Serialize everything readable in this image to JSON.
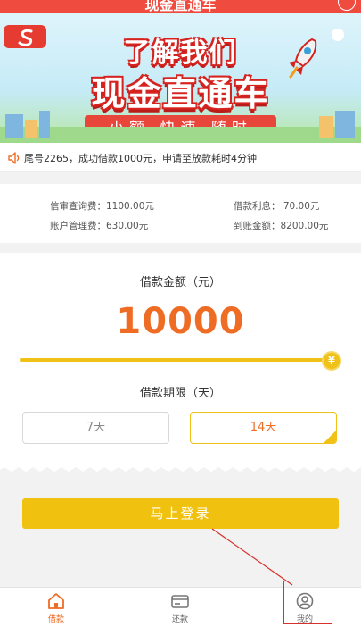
{
  "header": {
    "title": "现金直通车",
    "more_label": "···"
  },
  "banner": {
    "line1": "了解我们",
    "line2": "现金直通车",
    "ribbon": "小额 快速 随时"
  },
  "notice": {
    "text": "尾号2265，成功借款1000元，申请至放款耗时4分钟"
  },
  "fees": {
    "review_fee": "信审查询费：1100.00元",
    "account_fee": "账户管理费：630.00元",
    "interest": "借款利息：   70.00元",
    "received": "到账金额：8200.00元"
  },
  "loan": {
    "amount_label": "借款金额（元）",
    "amount": "10000",
    "slider_fraction": 1.0,
    "knob_symbol": "¥",
    "term_label": "借款期限（天）",
    "term_options": [
      "7天",
      "14天"
    ],
    "selected_term": "14天"
  },
  "login": {
    "button_label": "马上登录"
  },
  "tabbar": {
    "items": [
      {
        "label": "借款",
        "icon": "home-icon",
        "active": true
      },
      {
        "label": "还款",
        "icon": "repay-card-icon",
        "active": false
      },
      {
        "label": "我的",
        "icon": "user-profile-icon",
        "active": false
      }
    ]
  },
  "colors": {
    "brand_red": "#ef4c3f",
    "accent_orange": "#ef6c24",
    "accent_yellow": "#f1c10f",
    "highlight_red": "#d8302a"
  }
}
